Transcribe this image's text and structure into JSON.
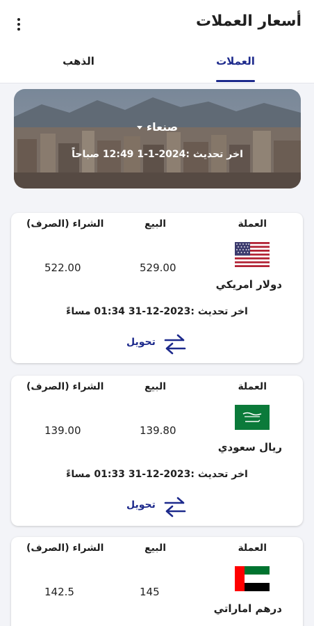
{
  "app": {
    "title": "أسعار العملات"
  },
  "tabs": [
    {
      "label": "العملات",
      "selected": true
    },
    {
      "label": "الذهب",
      "selected": false
    }
  ],
  "banner": {
    "city": "صنعاء",
    "last_update": "اخر تحديث :2024-1-1 12:49 صباحاً"
  },
  "table_headers": {
    "currency": "العملة",
    "sell": "البيع",
    "buy": "الشراء (الصرف)"
  },
  "convert_label": "تحويل",
  "currencies": [
    {
      "name": "دولار امريكي",
      "flag_icon": "us-flag-icon",
      "sell": "529.00",
      "buy": "522.00",
      "updated": "اخر تحديث :2023-12-31 01:34 مساءً"
    },
    {
      "name": "ريال سعودي",
      "flag_icon": "saudi-flag-icon",
      "sell": "139.80",
      "buy": "139.00",
      "updated": "اخر تحديث :2023-12-31 01:33 مساءً"
    },
    {
      "name": "درهم اماراتي",
      "flag_icon": "uae-flag-icon",
      "sell": "145",
      "buy": "142.5"
    }
  ],
  "colors": {
    "accent": "#1d2a8c",
    "background": "#f3f4f8",
    "card": "#ffffff"
  }
}
